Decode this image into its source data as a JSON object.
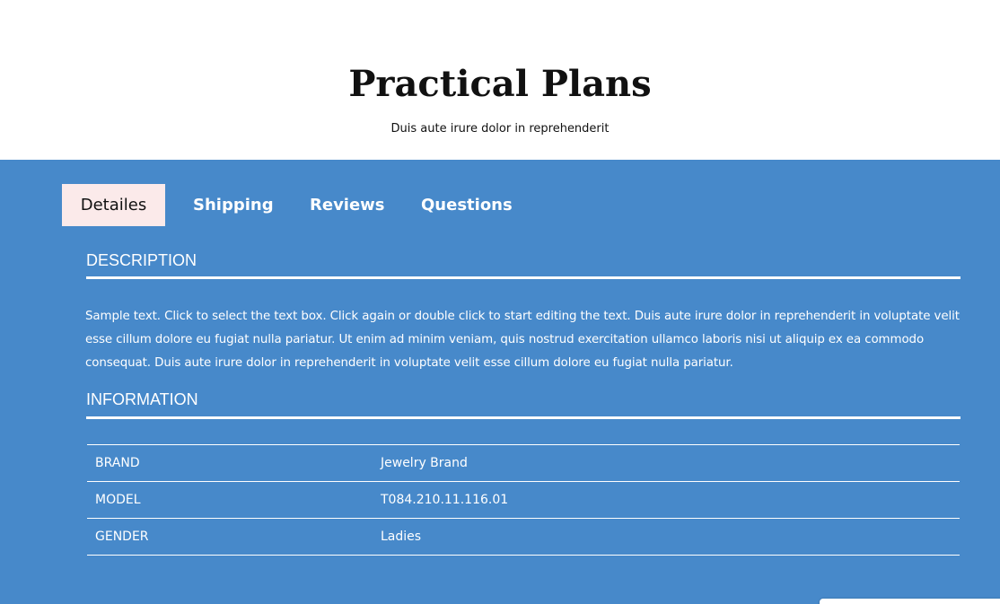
{
  "hero": {
    "title": "Practical Plans",
    "subtitle": "Duis aute irure dolor in reprehenderit"
  },
  "tabs": [
    {
      "label": "Detailes",
      "active": true
    },
    {
      "label": "Shipping",
      "active": false
    },
    {
      "label": "Reviews",
      "active": false
    },
    {
      "label": "Questions",
      "active": false
    }
  ],
  "description": {
    "heading": "DESCRIPTION",
    "text": "Sample text. Click to select the text box. Click again or double click to start editing the text. Duis aute irure dolor in reprehenderit in voluptate velit esse cillum dolore eu fugiat nulla pariatur. Ut enim ad minim veniam, quis nostrud exercitation ullamco laboris nisi ut aliquip ex ea commodo consequat. Duis aute irure dolor in reprehenderit in voluptate velit esse cillum dolore eu fugiat nulla pariatur."
  },
  "information": {
    "heading": "INFORMATION",
    "rows": [
      {
        "key": "BRAND",
        "value": "Jewelry Brand"
      },
      {
        "key": "MODEL",
        "value": "T084.210.11.116.01"
      },
      {
        "key": "GENDER",
        "value": "Ladies"
      }
    ]
  },
  "colors": {
    "panel_background": "#4789ca",
    "active_tab_background": "#fbeaea",
    "text_light": "#ffffff",
    "text_dark": "#111111"
  }
}
